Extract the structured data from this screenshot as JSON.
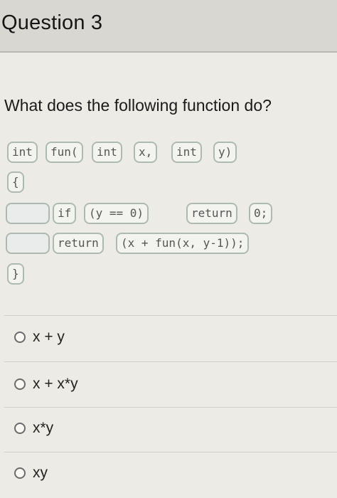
{
  "question": {
    "title": "Question 3",
    "prompt": "What does the following function do?"
  },
  "code": {
    "line1": [
      "int",
      "fun(",
      "int",
      "x,",
      "int",
      "y)"
    ],
    "open_brace": "{",
    "line3": {
      "if": "if",
      "cond": "(y == 0)",
      "return": "return",
      "value": "0;"
    },
    "line4": {
      "return": "return",
      "expr": "(x + fun(x, y-1));"
    },
    "close_brace": "}"
  },
  "options": [
    {
      "label": "x + y"
    },
    {
      "label": "x + x*y"
    },
    {
      "label": "x*y"
    },
    {
      "label": "xy"
    }
  ]
}
